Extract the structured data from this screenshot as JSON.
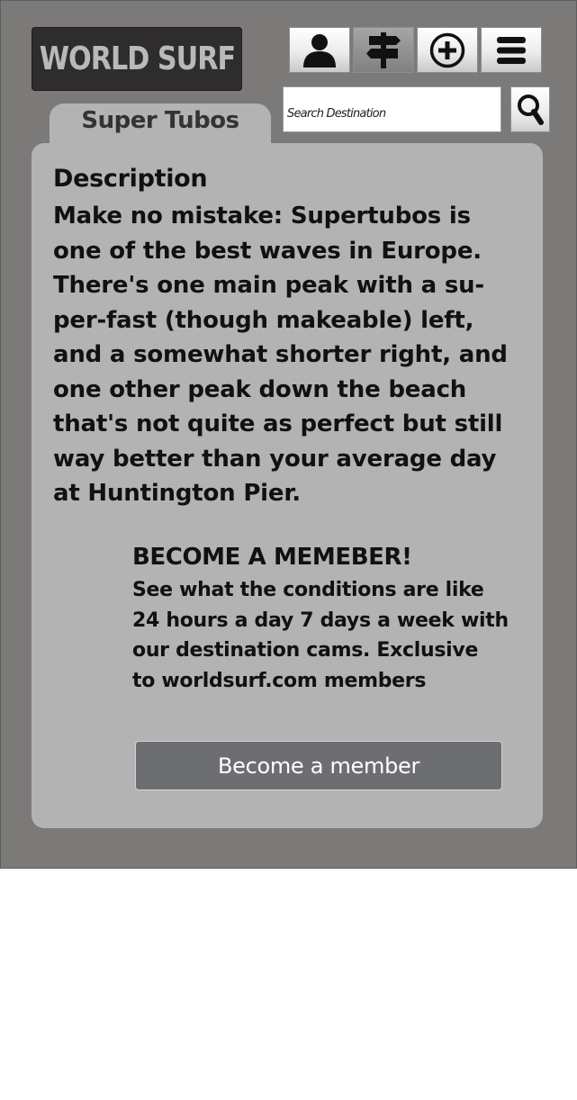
{
  "header": {
    "logo_text": "WORLD SURF",
    "nav_icons": [
      "user-icon",
      "signpost-icon",
      "add-circle-icon",
      "menu-icon"
    ],
    "active_nav": "signpost-icon",
    "search": {
      "placeholder": "Search Destination"
    }
  },
  "tab": {
    "label": "Super Tubos"
  },
  "description": {
    "heading": "Description",
    "lines": [
      "Make no mistake: Supertubos is",
      "one of the best waves in Europe.",
      "There's one main peak with a su-",
      "per-fast (though makeable) left,",
      "and a somewhat shorter right, and",
      "one other peak down the beach",
      "that's not quite as perfect but still",
      "way better than your average day",
      "at Huntington Pier."
    ]
  },
  "promo": {
    "heading": "BECOME A MEMEBER!",
    "lines": [
      "See what the conditions are like",
      "24 hours a day 7 days a week with",
      "our destination cams. Exclusive",
      "to worldsurf.com members"
    ],
    "button_label": "Become a member"
  },
  "colors": {
    "frame_background": "#7b7a79",
    "panel_background": "#b3b3b3",
    "logo_background": "#2e2c2c",
    "button_background": "#6d6e71"
  }
}
